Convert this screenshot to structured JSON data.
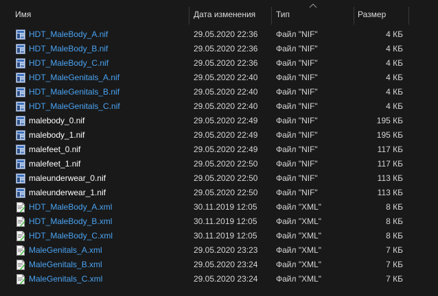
{
  "columns": {
    "name": "Имя",
    "date": "Дата изменения",
    "type": "Тип",
    "size": "Размер"
  },
  "files": [
    {
      "name": "HDT_MaleBody_A.nif",
      "date": "29.05.2020 22:36",
      "type": "Файл \"NIF\"",
      "size": "4 КБ",
      "icon": "nif-file-icon",
      "color": "blue"
    },
    {
      "name": "HDT_MaleBody_B.nif",
      "date": "29.05.2020 22:36",
      "type": "Файл \"NIF\"",
      "size": "4 КБ",
      "icon": "nif-file-icon",
      "color": "blue"
    },
    {
      "name": "HDT_MaleBody_C.nif",
      "date": "29.05.2020 22:36",
      "type": "Файл \"NIF\"",
      "size": "4 КБ",
      "icon": "nif-file-icon",
      "color": "blue"
    },
    {
      "name": "HDT_MaleGenitals_A.nif",
      "date": "29.05.2020 22:40",
      "type": "Файл \"NIF\"",
      "size": "4 КБ",
      "icon": "nif-file-icon",
      "color": "blue"
    },
    {
      "name": "HDT_MaleGenitals_B.nif",
      "date": "29.05.2020 22:40",
      "type": "Файл \"NIF\"",
      "size": "4 КБ",
      "icon": "nif-file-icon",
      "color": "blue"
    },
    {
      "name": "HDT_MaleGenitals_C.nif",
      "date": "29.05.2020 22:40",
      "type": "Файл \"NIF\"",
      "size": "4 КБ",
      "icon": "nif-file-icon",
      "color": "blue"
    },
    {
      "name": "malebody_0.nif",
      "date": "29.05.2020 22:49",
      "type": "Файл \"NIF\"",
      "size": "195 КБ",
      "icon": "nif-file-icon",
      "color": "white"
    },
    {
      "name": "malebody_1.nif",
      "date": "29.05.2020 22:49",
      "type": "Файл \"NIF\"",
      "size": "195 КБ",
      "icon": "nif-file-icon",
      "color": "white"
    },
    {
      "name": "malefeet_0.nif",
      "date": "29.05.2020 22:49",
      "type": "Файл \"NIF\"",
      "size": "117 КБ",
      "icon": "nif-file-icon",
      "color": "white"
    },
    {
      "name": "malefeet_1.nif",
      "date": "29.05.2020 22:50",
      "type": "Файл \"NIF\"",
      "size": "117 КБ",
      "icon": "nif-file-icon",
      "color": "white"
    },
    {
      "name": "maleunderwear_0.nif",
      "date": "29.05.2020 22:50",
      "type": "Файл \"NIF\"",
      "size": "113 КБ",
      "icon": "nif-file-icon",
      "color": "white"
    },
    {
      "name": "maleunderwear_1.nif",
      "date": "29.05.2020 22:50",
      "type": "Файл \"NIF\"",
      "size": "113 КБ",
      "icon": "nif-file-icon",
      "color": "white"
    },
    {
      "name": "HDT_MaleBody_A.xml",
      "date": "30.11.2019 12:05",
      "type": "Файл \"XML\"",
      "size": "8 КБ",
      "icon": "xml-file-icon",
      "color": "blue"
    },
    {
      "name": "HDT_MaleBody_B.xml",
      "date": "30.11.2019 12:05",
      "type": "Файл \"XML\"",
      "size": "8 КБ",
      "icon": "xml-file-icon",
      "color": "blue"
    },
    {
      "name": "HDT_MaleBody_C.xml",
      "date": "30.11.2019 12:05",
      "type": "Файл \"XML\"",
      "size": "8 КБ",
      "icon": "xml-file-icon",
      "color": "blue"
    },
    {
      "name": "MaleGenitals_A.xml",
      "date": "29.05.2020 23:23",
      "type": "Файл \"XML\"",
      "size": "7 КБ",
      "icon": "xml-file-icon",
      "color": "blue"
    },
    {
      "name": "MaleGenitals_B.xml",
      "date": "29.05.2020 23:24",
      "type": "Файл \"XML\"",
      "size": "7 КБ",
      "icon": "xml-file-icon",
      "color": "blue"
    },
    {
      "name": "MaleGenitals_C.xml",
      "date": "29.05.2020 23:24",
      "type": "Файл \"XML\"",
      "size": "7 КБ",
      "icon": "xml-file-icon",
      "color": "blue"
    }
  ],
  "colors": {
    "background": "#191919",
    "link_blue": "#4aa3f2",
    "text": "#d6d6d6"
  }
}
